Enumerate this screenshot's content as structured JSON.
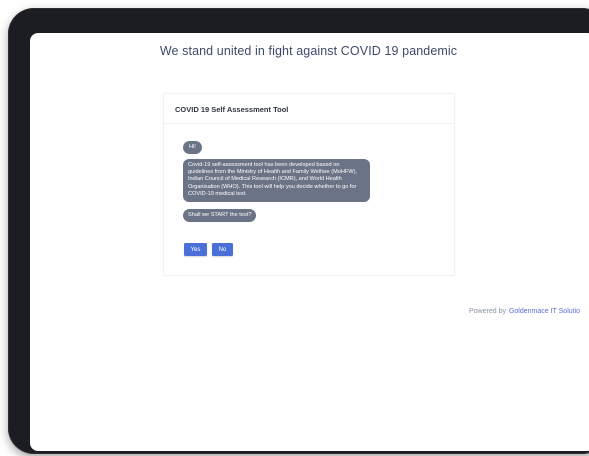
{
  "header": {
    "title": "We stand united in fight against COVID 19 pandemic"
  },
  "card": {
    "title": "COVID 19 Self Assessment Tool"
  },
  "chat": {
    "messages": [
      {
        "text": "Hi!"
      },
      {
        "text": "Covid-19 self-assessment tool has been developed based on guidelines from the Ministry of Health and Family Welfare (MoHFW), Indian Council of Medical Research (ICMR), and World Health Organisation (WHO). This tool will help you decide whether to go for COVID-19 medical test."
      },
      {
        "text": "Shall we START the test?"
      }
    ],
    "options": [
      {
        "label": "Yes"
      },
      {
        "label": "No"
      }
    ]
  },
  "footer": {
    "powered_label": "Powered by",
    "company": "Goldenmace IT Solutio"
  },
  "colors": {
    "accent": "#4b6fd8",
    "bubble": "#6b7387",
    "device_frame": "#1c1d22"
  }
}
